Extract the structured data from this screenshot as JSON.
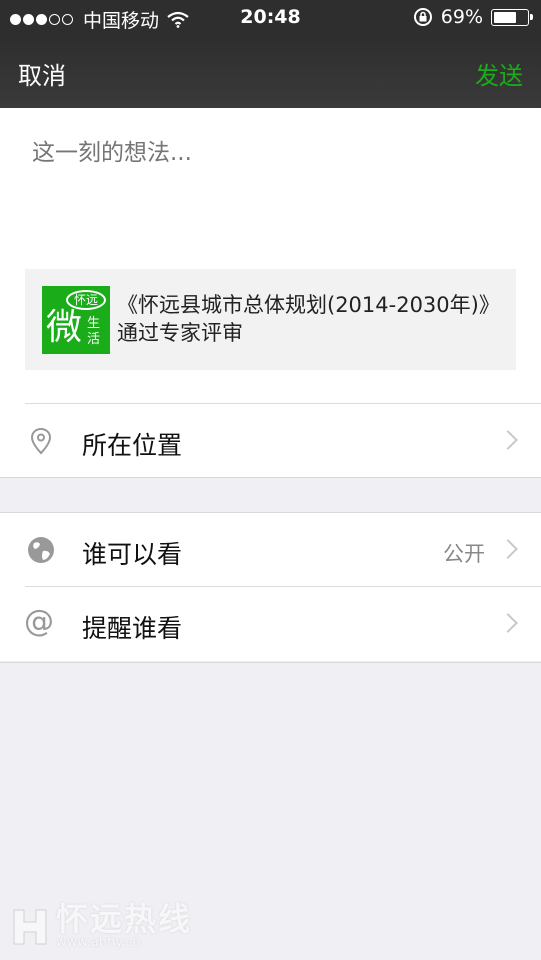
{
  "status_bar": {
    "carrier": "中国移动",
    "time": "20:48",
    "battery_percent": "69%",
    "battery_level": 0.69,
    "signal_bars_filled": 3,
    "signal_bars_total": 5,
    "icons": [
      "signal-dots-icon",
      "wifi-icon",
      "rotation-lock-icon",
      "battery-icon"
    ]
  },
  "nav": {
    "cancel_label": "取消",
    "send_label": "发送",
    "send_color": "#1aad19"
  },
  "compose": {
    "placeholder": "这一刻的想法..."
  },
  "share_card": {
    "thumb_badge": "怀远",
    "thumb_big": "微",
    "thumb_small": "生活",
    "title": "《怀远县城市总体规划(2014-2030年)》通过专家评审"
  },
  "options": {
    "location": {
      "label": "所在位置",
      "icon": "location-pin-icon"
    },
    "visibility": {
      "label": "谁可以看",
      "value": "公开",
      "icon": "globe-icon"
    },
    "mention": {
      "label": "提醒谁看",
      "icon": "at-icon"
    }
  },
  "watermark": {
    "main": "怀远热线",
    "sub": "www.ahhy.cn"
  },
  "colors": {
    "accent": "#1aad19",
    "nav_bg": "#2e2e2e",
    "page_bg": "#efeff4"
  }
}
